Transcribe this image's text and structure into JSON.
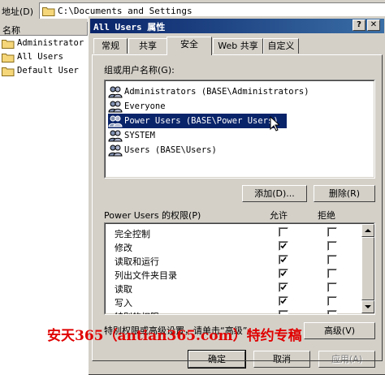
{
  "address": {
    "label": "地址(D)",
    "path": "C:\\Documents and Settings"
  },
  "left_pane": {
    "header": "名称",
    "items": [
      {
        "name": "Administrator"
      },
      {
        "name": "All Users"
      },
      {
        "name": "Default User"
      }
    ]
  },
  "dialog": {
    "title": "All Users 属性",
    "help_btn": "?",
    "close_btn": "✕",
    "tabs": [
      {
        "label": "常规"
      },
      {
        "label": "共享"
      },
      {
        "label": "安全",
        "active": true
      },
      {
        "label": "Web 共享"
      },
      {
        "label": "自定义"
      }
    ],
    "groups_label": "组或用户名称(G):",
    "groups": [
      {
        "name": "Administrators (BASE\\Administrators)"
      },
      {
        "name": "Everyone"
      },
      {
        "name": "Power Users (BASE\\Power Users)",
        "selected": true
      },
      {
        "name": "SYSTEM"
      },
      {
        "name": "Users (BASE\\Users)"
      }
    ],
    "add_button": "添加(D)...",
    "remove_button": "删除(R)",
    "perm_label": "Power Users 的权限(P)",
    "allow_header": "允许",
    "deny_header": "拒绝",
    "permissions": [
      {
        "name": "完全控制",
        "allow": false,
        "deny": false
      },
      {
        "name": "修改",
        "allow": true,
        "deny": false
      },
      {
        "name": "读取和运行",
        "allow": true,
        "deny": false
      },
      {
        "name": "列出文件夹目录",
        "allow": true,
        "deny": false
      },
      {
        "name": "读取",
        "allow": true,
        "deny": false
      },
      {
        "name": "写入",
        "allow": true,
        "deny": false
      },
      {
        "name": "特别的权限",
        "allow": false,
        "deny": false
      }
    ],
    "advanced_text": "特别权限或高级设置，请单击“高级”。",
    "advanced_button": "高级(V)",
    "ok_button": "确定",
    "cancel_button": "取消",
    "apply_button": "应用(A)"
  },
  "watermark": "安天365（antian365.com）特约专稿"
}
